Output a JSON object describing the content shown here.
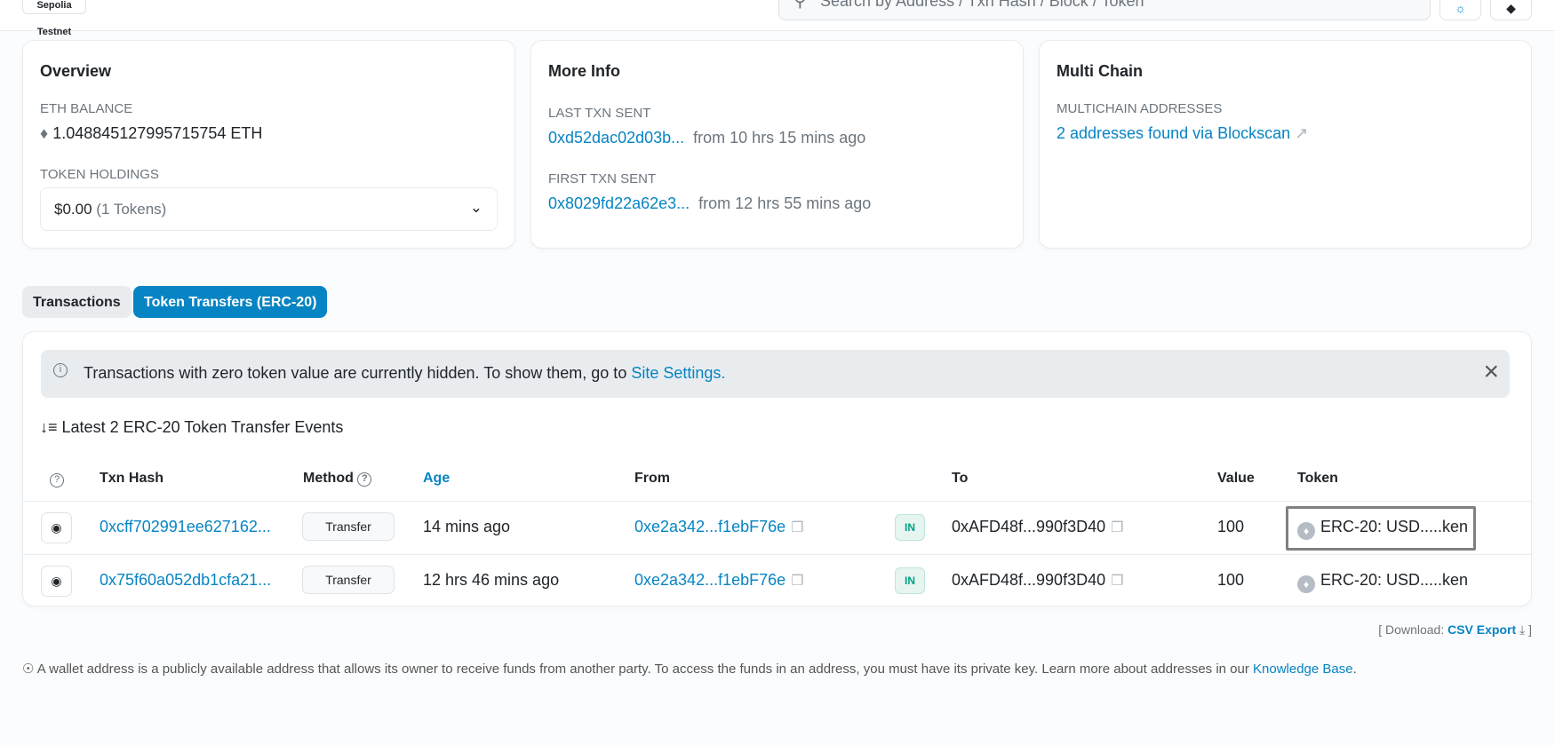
{
  "header": {
    "network": "Sepolia Testnet",
    "search_placeholder": "Search by Address / Txn Hash / Block / Token"
  },
  "overview": {
    "title": "Overview",
    "eth_balance_label": "ETH BALANCE",
    "eth_balance": "1.048845127995715754 ETH",
    "token_holdings_label": "TOKEN HOLDINGS",
    "token_value": "$0.00",
    "token_count": "(1 Tokens)"
  },
  "more_info": {
    "title": "More Info",
    "last_label": "LAST TXN SENT",
    "last_hash": "0xd52dac02d03b...",
    "last_time": "from 10 hrs 15 mins ago",
    "first_label": "FIRST TXN SENT",
    "first_hash": "0x8029fd22a62e3...",
    "first_time": "from 12 hrs 55 mins ago"
  },
  "multi_chain": {
    "title": "Multi Chain",
    "label": "MULTICHAIN ADDRESSES",
    "link": "2 addresses found via Blockscan"
  },
  "tabs": [
    {
      "label": "Transactions",
      "active": false
    },
    {
      "label": "Token Transfers (ERC-20)",
      "active": true
    }
  ],
  "alert": {
    "text": "Transactions with zero token value are currently hidden. To show them, go to ",
    "link": "Site Settings."
  },
  "summary": "Latest 2 ERC-20 Token Transfer Events",
  "columns": [
    "Txn Hash",
    "Method",
    "Age",
    "From",
    "To",
    "Value",
    "Token"
  ],
  "rows": [
    {
      "hash": "0xcff702991ee627162...",
      "method": "Transfer",
      "age": "14 mins ago",
      "from": "0xe2a342...f1ebF76e",
      "direction": "IN",
      "to": "0xAFD48f...990f3D40",
      "value": "100",
      "token": "ERC-20: USD.....ken"
    },
    {
      "hash": "0x75f60a052db1cfa21...",
      "method": "Transfer",
      "age": "12 hrs 46 mins ago",
      "from": "0xe2a342...f1ebF76e",
      "direction": "IN",
      "to": "0xAFD48f...990f3D40",
      "value": "100",
      "token": "ERC-20: USD.....ken"
    }
  ],
  "download": {
    "prefix": "[ Download:",
    "link": "CSV Export",
    "suffix": "]"
  },
  "footer": {
    "text": "A wallet address is a publicly available address that allows its owner to receive funds from another party. To access the funds in an address, you must have its private key. Learn more about addresses in our ",
    "link": "Knowledge Base",
    "end": "."
  },
  "colors": {
    "accent": "#0784c3",
    "in_badge": "#00a186"
  }
}
